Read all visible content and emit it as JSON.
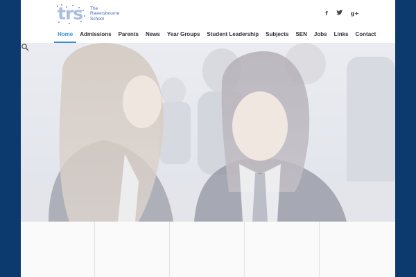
{
  "brand": {
    "logo_word": "trs",
    "logo_line1": "The",
    "logo_line2": "Ravensbourne",
    "logo_line3": "School",
    "accent_color": "#3a8ed6",
    "frame_color": "#0c3a6e"
  },
  "social": [
    {
      "icon": "facebook-icon",
      "glyph": "f"
    },
    {
      "icon": "twitter-icon",
      "glyph": "t"
    },
    {
      "icon": "google-plus-icon",
      "glyph": "g+"
    }
  ],
  "nav": {
    "items": [
      {
        "label": "Home",
        "active": true
      },
      {
        "label": "Admissions"
      },
      {
        "label": "Parents"
      },
      {
        "label": "News"
      },
      {
        "label": "Year Groups"
      },
      {
        "label": "Student Leadership"
      },
      {
        "label": "Subjects"
      },
      {
        "label": "SEN"
      },
      {
        "label": "Jobs"
      },
      {
        "label": "Links"
      },
      {
        "label": "Contact"
      }
    ]
  },
  "hero": {
    "image": "two-students-laughing-photo",
    "search_icon": "search-icon"
  },
  "tiles": {
    "count": 5
  }
}
